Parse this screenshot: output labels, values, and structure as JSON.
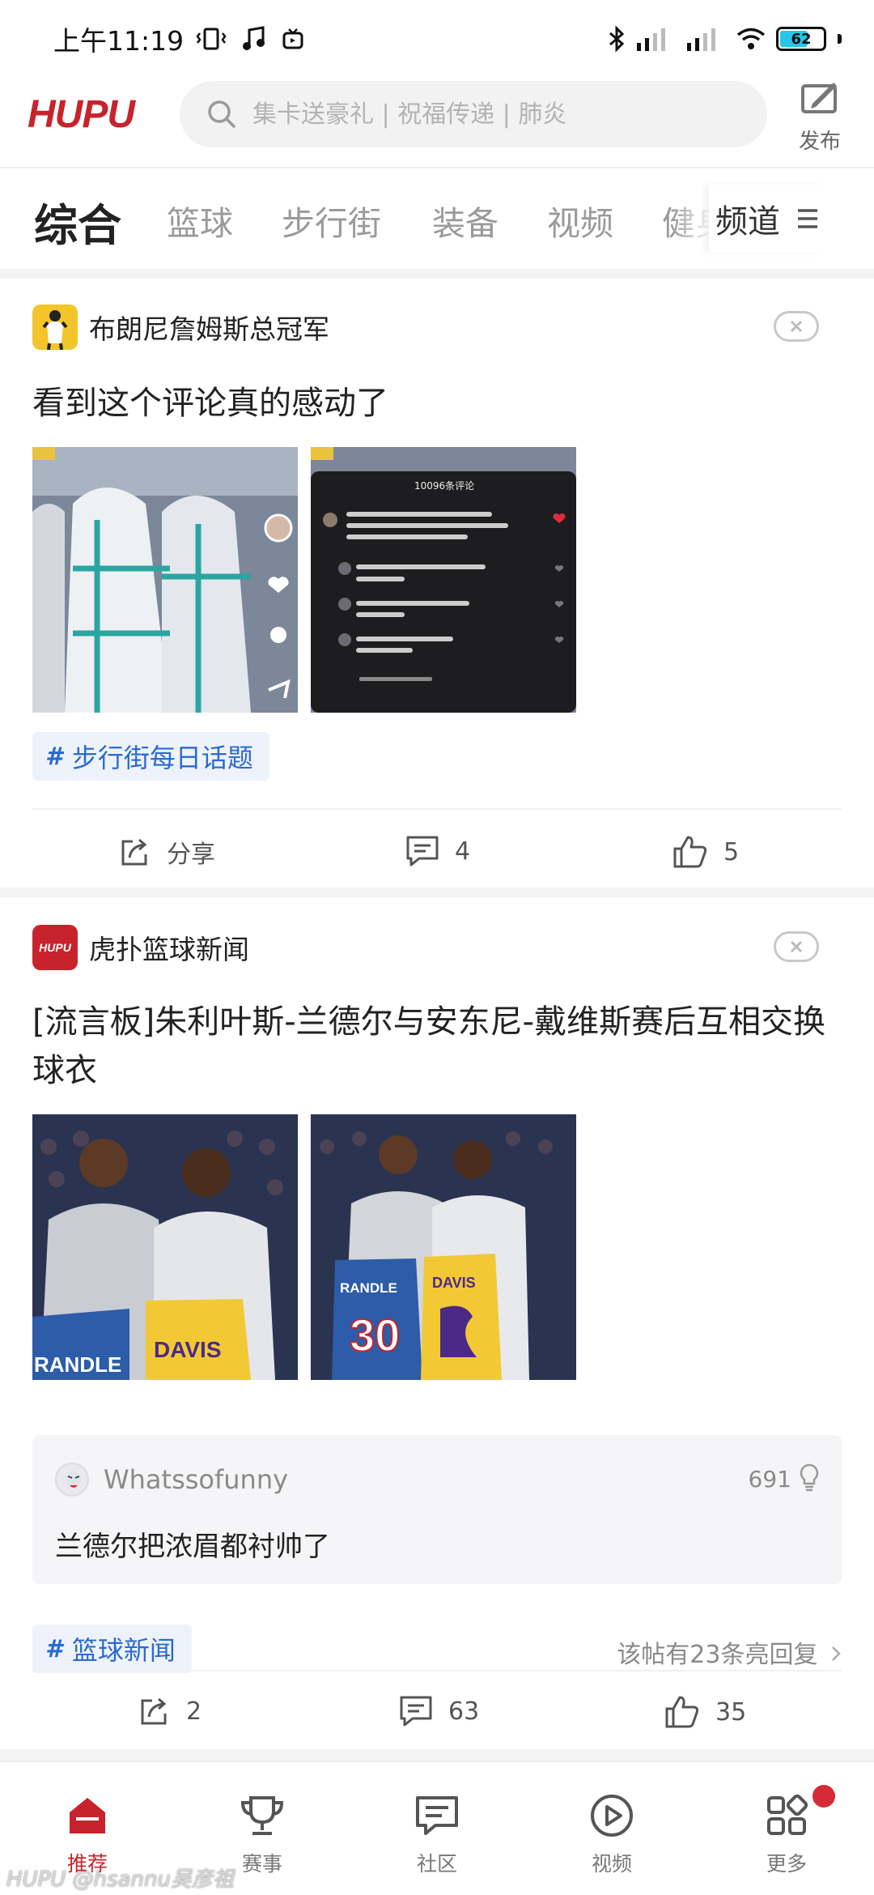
{
  "status_bar": {
    "time": "上午11:19",
    "battery": "62"
  },
  "header": {
    "logo": "HUPU",
    "search_placeholder": "集卡送豪礼 | 祝福传递 | 肺炎",
    "publish_label": "发布"
  },
  "tabs": {
    "items": [
      "综合",
      "篮球",
      "步行街",
      "装备",
      "视频",
      "健身"
    ],
    "active_index": 0,
    "channels_label": "频道"
  },
  "posts": [
    {
      "source": "布朗尼詹姆斯总冠军",
      "title": "看到这个评论真的感动了",
      "image_comment_header": "10096条评论",
      "topic": "步行街每日话题",
      "actions": {
        "share": "分享",
        "comments": "4",
        "likes": "5"
      }
    },
    {
      "source": "虎扑篮球新闻",
      "source_badge": "HUPU",
      "title": "[流言板]朱利叶斯-兰德尔与安东尼-戴维斯赛后互相交换球衣",
      "jersey_names": [
        "RANDLE",
        "DAVIS"
      ],
      "jersey_number": "30",
      "hot_comment": {
        "user": "Whatssofunny",
        "likes": "691",
        "text": "兰德尔把浓眉都衬帅了"
      },
      "topic": "篮球新闻",
      "reply_hint": "该帖有23条亮回复",
      "actions": {
        "share": "2",
        "comments": "63",
        "likes": "35"
      }
    }
  ],
  "bottom_nav": {
    "items": [
      "推荐",
      "赛事",
      "社区",
      "视频",
      "更多"
    ],
    "active_index": 0
  },
  "watermark": "HUPU @hsannu吴彦祖",
  "colors": {
    "brand": "#c8232c",
    "topic": "#2a6ad1",
    "battery": "#26c6e8"
  }
}
